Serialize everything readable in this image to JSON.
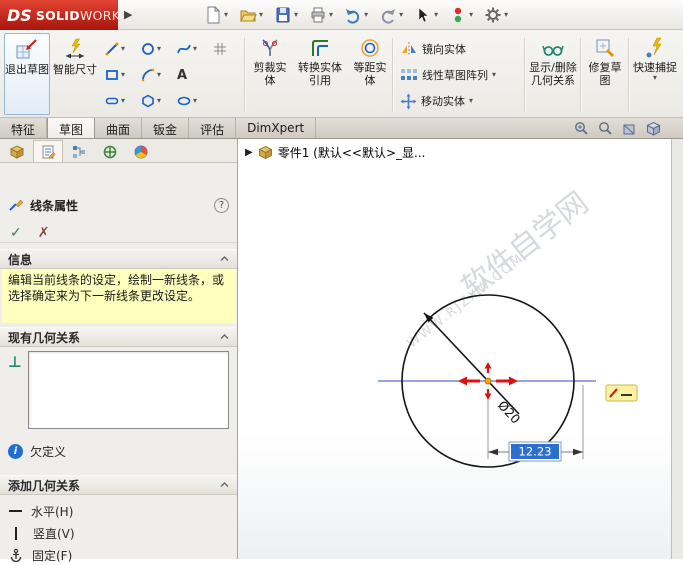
{
  "icons": {
    "caret": "▾",
    "flyout": "▶",
    "check": "✓",
    "cross": "✗",
    "help": "?",
    "info": "i",
    "perp": "⊥",
    "text_tool": "A"
  },
  "titlebar": {
    "logo_ds": "DS",
    "logo_solid": "SOLID",
    "logo_works": "WORKS"
  },
  "ribbon": {
    "exit_sketch": "退出草图",
    "smart_dimension": "智能尺寸",
    "trim": "剪裁实体",
    "convert": "转换实体引用",
    "offset": "等距实体",
    "mirror": "镜向实体",
    "linear_pattern": "线性草图阵列",
    "move": "移动实体",
    "display_delete": "显示/删除几何关系",
    "repair": "修复草图",
    "quick_snap": "快速捕捉"
  },
  "tabs": {
    "items": [
      "特征",
      "草图",
      "曲面",
      "钣金",
      "评估",
      "DimXpert"
    ],
    "active": "草图"
  },
  "panel": {
    "title": "线条属性",
    "message_header": "信息",
    "message_text": "编辑当前线条的设定，绘制一新线条，或选择确定来为下一新线条更改设定。",
    "existing_relations_header": "现有几何关系",
    "status": "欠定义",
    "add_relations_header": "添加几何关系",
    "relation_horizontal": "水平(H)",
    "relation_vertical": "竖直(V)",
    "relation_fix": "固定(F)"
  },
  "graphics": {
    "tree_item": "零件1 (默认<<默认>_显...",
    "diameter_dim": "Ø20",
    "dim_value": "12.23",
    "watermark_cn": "软件自学网",
    "watermark_en": "WWW.RJZXW.COM"
  }
}
